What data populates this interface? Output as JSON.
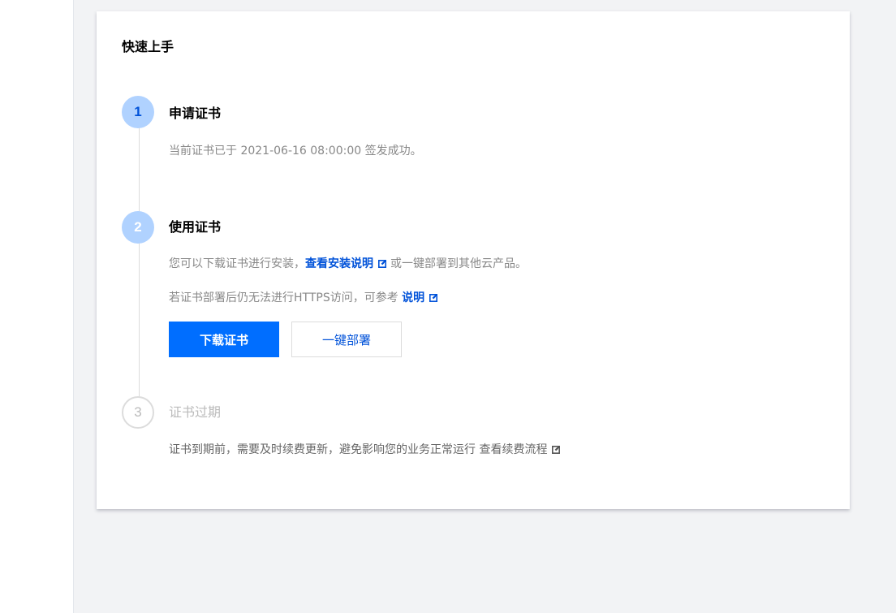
{
  "card": {
    "title": "快速上手"
  },
  "steps": [
    {
      "number": "1",
      "title": "申请证书",
      "desc": "当前证书已于 2021-06-16 08:00:00 签发成功。"
    },
    {
      "number": "2",
      "title": "使用证书",
      "desc_line1_prefix": "您可以下载证书进行安装，",
      "desc_line1_link": "查看安装说明",
      "desc_line1_suffix": "或一键部署到其他云产品。",
      "desc_line2_prefix": "若证书部署后仍无法进行HTTPS访问，可参考",
      "desc_line2_link": "说明",
      "download_button": "下载证书",
      "deploy_button": "一键部署"
    },
    {
      "number": "3",
      "title": "证书过期",
      "desc_prefix": "证书到期前，需要及时续费更新，避免影响您的业务正常运行",
      "desc_link": "查看续费流程"
    }
  ],
  "icons": {
    "external_link": "external-link-icon"
  },
  "colors": {
    "primary": "#006eff",
    "link": "#0052d9",
    "step_circle_bg": "#b0d2ff",
    "muted_text": "#888888",
    "pending_text": "#bbbbbb"
  }
}
